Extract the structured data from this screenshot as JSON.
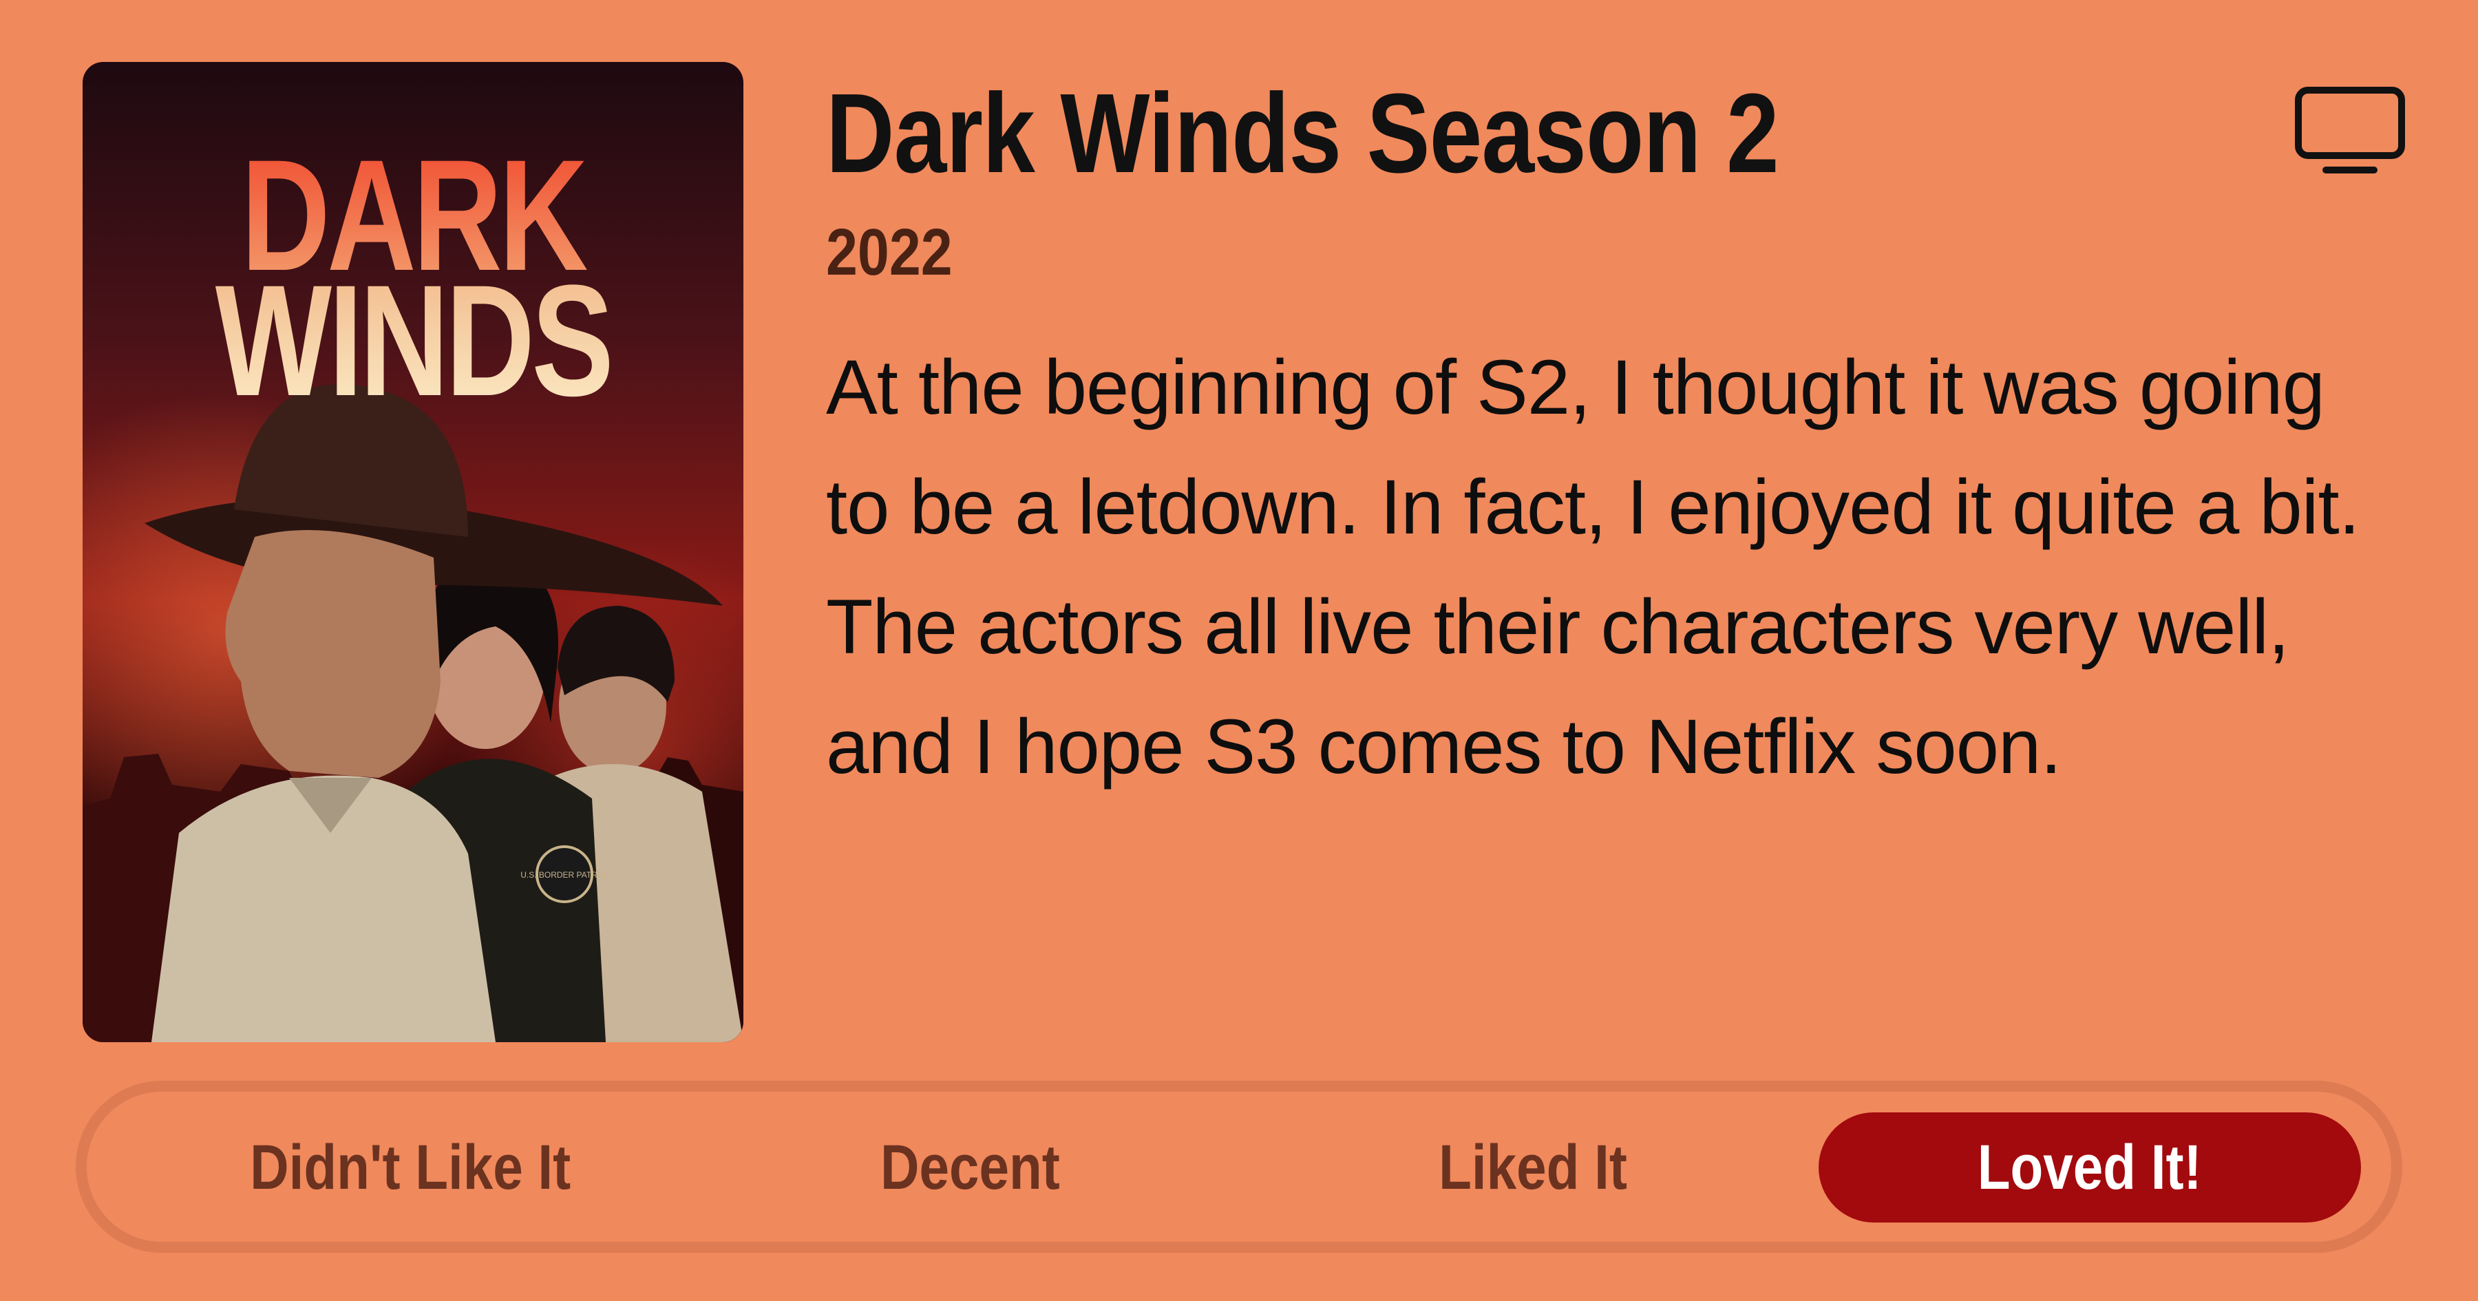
{
  "show": {
    "title": "Dark Winds Season 2",
    "year": "2022",
    "review": "At the beginning of S2, I thought it was going to be a letdown. In fact, I enjoyed it quite a bit. The actors all live their characters very well, and I hope S3 comes to Netflix soon.",
    "poster": {
      "title_line1": "DARK",
      "title_line2": "WINDS",
      "badge_text": "U.S. BORDER PATROL"
    }
  },
  "icons": {
    "media_type": "tv-icon"
  },
  "rating": {
    "options": [
      "Didn't Like It",
      "Decent",
      "Liked It",
      "Loved It!"
    ],
    "selected": "Loved It!"
  },
  "colors": {
    "background": "#F0895C",
    "selected_pill": "#A30A0E",
    "option_text": "#6B3220",
    "track_border": "#DE7B53"
  }
}
